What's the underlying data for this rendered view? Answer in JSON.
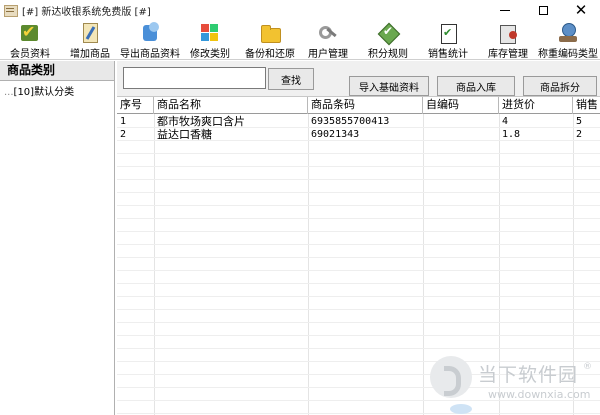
{
  "window": {
    "title": "[#] 新达收银系统免费版 [#]",
    "minimize": "—",
    "maximize": "□",
    "close": "✕"
  },
  "toolbar": {
    "items": [
      {
        "label": "会员资料",
        "icon": "member-icon"
      },
      {
        "label": "增加商品",
        "icon": "add-product-icon"
      },
      {
        "label": "导出商品资料",
        "icon": "export-icon"
      },
      {
        "label": "修改类别",
        "icon": "modify-category-icon"
      },
      {
        "label": "备份和还原",
        "icon": "backup-folder-icon"
      },
      {
        "label": "用户管理",
        "icon": "user-keys-icon"
      },
      {
        "label": "积分规则",
        "icon": "points-rule-icon"
      },
      {
        "label": "销售统计",
        "icon": "sales-clipboard-icon"
      },
      {
        "label": "库存管理",
        "icon": "stock-icon"
      },
      {
        "label": "称重编码类型",
        "icon": "weighing-icon"
      }
    ]
  },
  "sidebar": {
    "header": "商品类别",
    "tree": [
      {
        "prefix": "...",
        "label": "[10]默认分类"
      }
    ]
  },
  "search": {
    "value": "",
    "button": "查找"
  },
  "actions": {
    "import": "导入基础资料",
    "stock_in": "商品入库",
    "split": "商品拆分"
  },
  "table": {
    "columns": [
      "序号",
      "商品名称",
      "商品条码",
      "自编码",
      "进货价",
      "销售"
    ],
    "rows": [
      [
        "1",
        "都市牧场爽口含片",
        "6935855700413",
        "",
        "4",
        "5"
      ],
      [
        "2",
        "益达口香糖",
        "69021343",
        "",
        "1.8",
        "2"
      ]
    ]
  },
  "watermark": {
    "text": "当下软件园",
    "url": "www.downxia.com",
    "mark": "®"
  }
}
